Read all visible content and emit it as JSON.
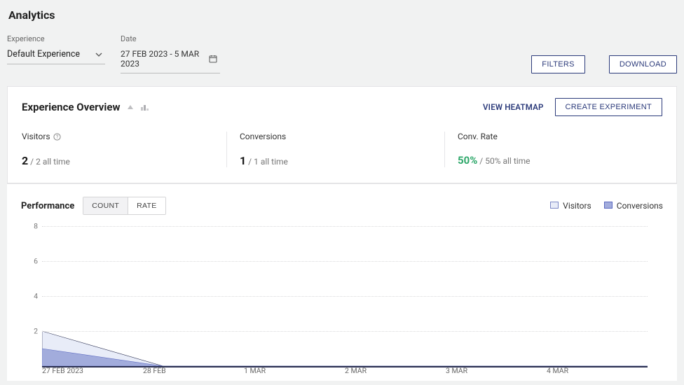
{
  "page": {
    "title": "Analytics"
  },
  "filters": {
    "experience_label": "Experience",
    "experience_value": "Default Experience",
    "date_label": "Date",
    "date_value": "27 FEB 2023 - 5 MAR 2023",
    "filters_btn": "FILTERS",
    "download_btn": "DOWNLOAD"
  },
  "overview": {
    "title": "Experience Overview",
    "view_heatmap": "VIEW HEATMAP",
    "create_experiment": "CREATE EXPERIMENT",
    "metrics": {
      "visitors": {
        "label": "Visitors",
        "value": "2",
        "suffix": "/ 2 all time"
      },
      "conversions": {
        "label": "Conversions",
        "value": "1",
        "suffix": "/ 1 all time"
      },
      "convrate": {
        "label": "Conv. Rate",
        "value": "50%",
        "suffix": "/ 50% all time"
      }
    }
  },
  "performance": {
    "title": "Performance",
    "tab_count": "COUNT",
    "tab_rate": "RATE",
    "legend_visitors": "Visitors",
    "legend_conversions": "Conversions"
  },
  "chart_data": {
    "type": "area",
    "x": [
      "27 FEB 2023",
      "28 FEB",
      "1 MAR",
      "2 MAR",
      "3 MAR",
      "4 MAR"
    ],
    "series": [
      {
        "name": "Visitors",
        "values": [
          2,
          0,
          0,
          0,
          0,
          0
        ],
        "color": "#e8ecf8",
        "stroke": "#2a2f50"
      },
      {
        "name": "Conversions",
        "values": [
          1,
          0,
          0,
          0,
          0,
          0
        ],
        "color": "#a2acdc",
        "stroke": "#5a68c0"
      }
    ],
    "ylabel": "",
    "xlabel": "",
    "ylim": [
      0,
      8
    ],
    "yticks": [
      2,
      4,
      6,
      8
    ]
  }
}
